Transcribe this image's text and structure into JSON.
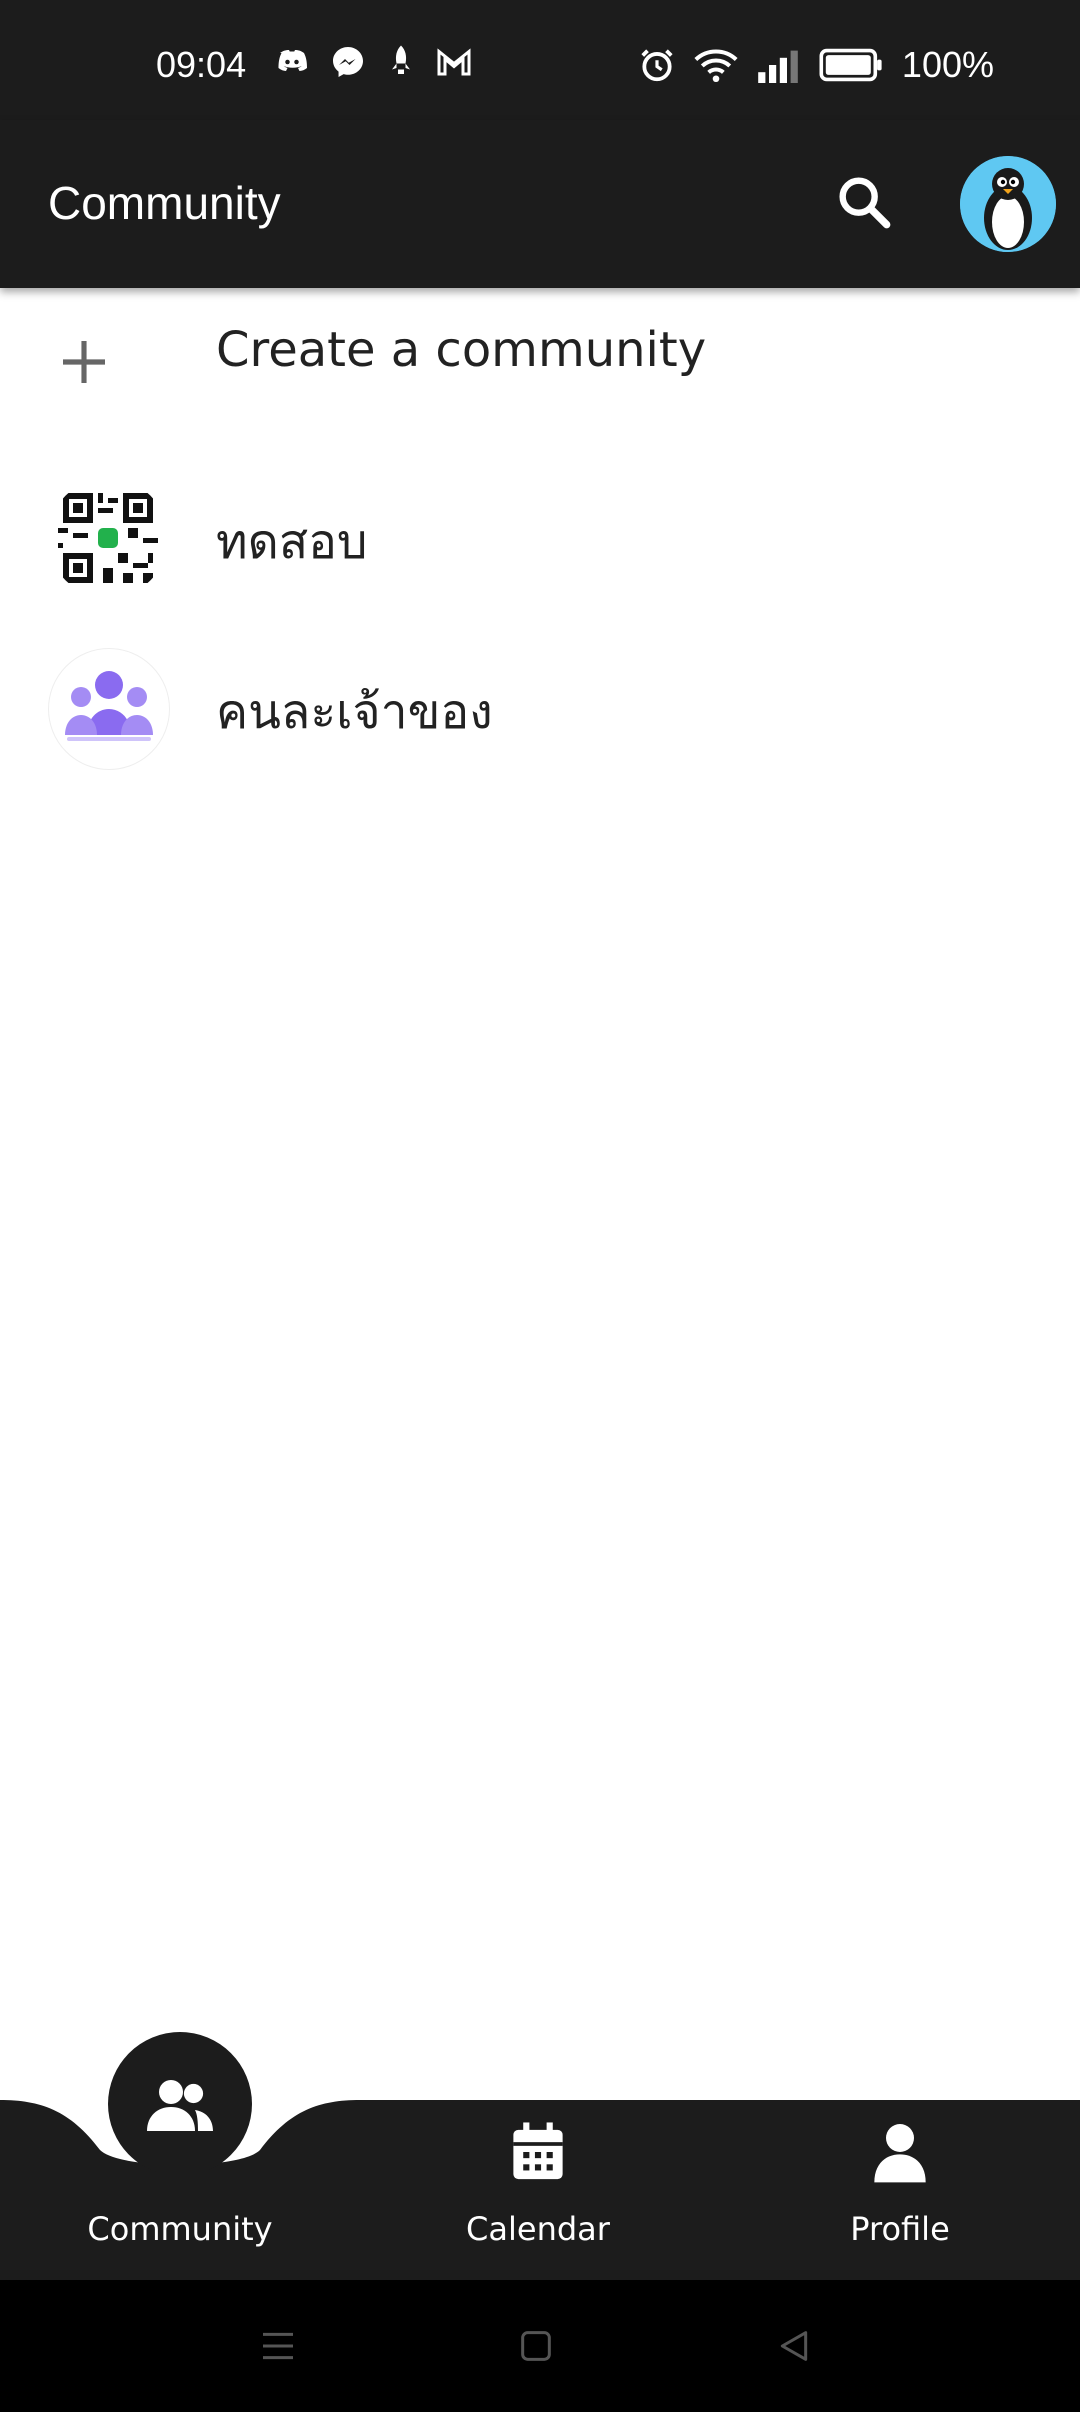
{
  "status_bar": {
    "time": "09:04",
    "battery": "100%",
    "left_icons": [
      "discord-icon",
      "messenger-icon",
      "rocket-icon",
      "gmail-icon"
    ],
    "right_icons": [
      "alarm-icon",
      "wifi-icon",
      "signal-icon",
      "battery-icon"
    ]
  },
  "app_bar": {
    "title": "Community",
    "search_icon": "search-icon",
    "avatar_icon": "penguin-avatar"
  },
  "list": {
    "create_label": "Create a community",
    "communities": [
      {
        "name": "ทดสอบ",
        "avatar": "qr-code-avatar"
      },
      {
        "name": "คนละเจ้าของ",
        "avatar": "group-avatar"
      }
    ]
  },
  "bottom_nav": {
    "items": [
      {
        "label": "Community",
        "icon": "people-icon",
        "active": true
      },
      {
        "label": "Calendar",
        "icon": "calendar-icon",
        "active": false
      },
      {
        "label": "Profile",
        "icon": "person-icon",
        "active": false
      }
    ]
  },
  "colors": {
    "bar": "#1c1c1c",
    "background": "#ffffff",
    "group_avatar_purple": "#8a6bf0",
    "avatar_blue": "#5fc8f2"
  }
}
